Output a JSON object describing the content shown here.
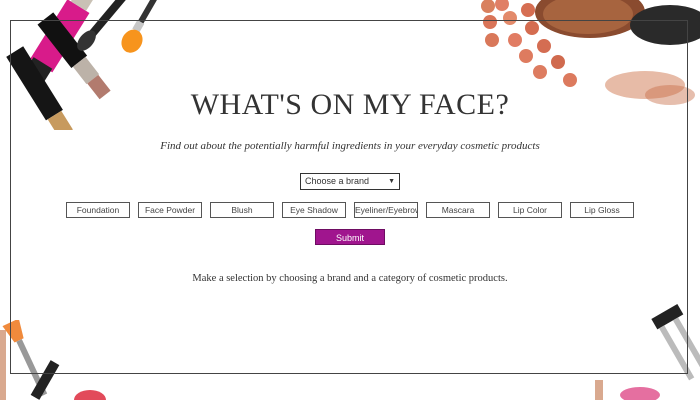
{
  "page": {
    "title": "WHAT'S ON MY FACE?",
    "subtitle": "Find out about the potentially harmful ingredients in your everyday cosmetic products",
    "instruction": "Make a selection by choosing a brand and a category of cosmetic products."
  },
  "brand_select": {
    "value": "Choose a brand",
    "caret": "▼"
  },
  "categories": [
    {
      "label": "Foundation"
    },
    {
      "label": "Face Powder"
    },
    {
      "label": "Blush"
    },
    {
      "label": "Eye Shadow"
    },
    {
      "label": "Eyeliner/Eyebrow"
    },
    {
      "label": "Mascara"
    },
    {
      "label": "Lip Color"
    },
    {
      "label": "Lip Gloss"
    }
  ],
  "submit": {
    "label": "Submit"
  },
  "colors": {
    "accent": "#a0158e",
    "frame": "#444444"
  },
  "decorations": {
    "top_left": "lipstick-and-brushes",
    "top_right": "blush-beads-and-powder-brush",
    "bottom_left": "makeup-brushes",
    "bottom_right": "eyelash-curler"
  }
}
